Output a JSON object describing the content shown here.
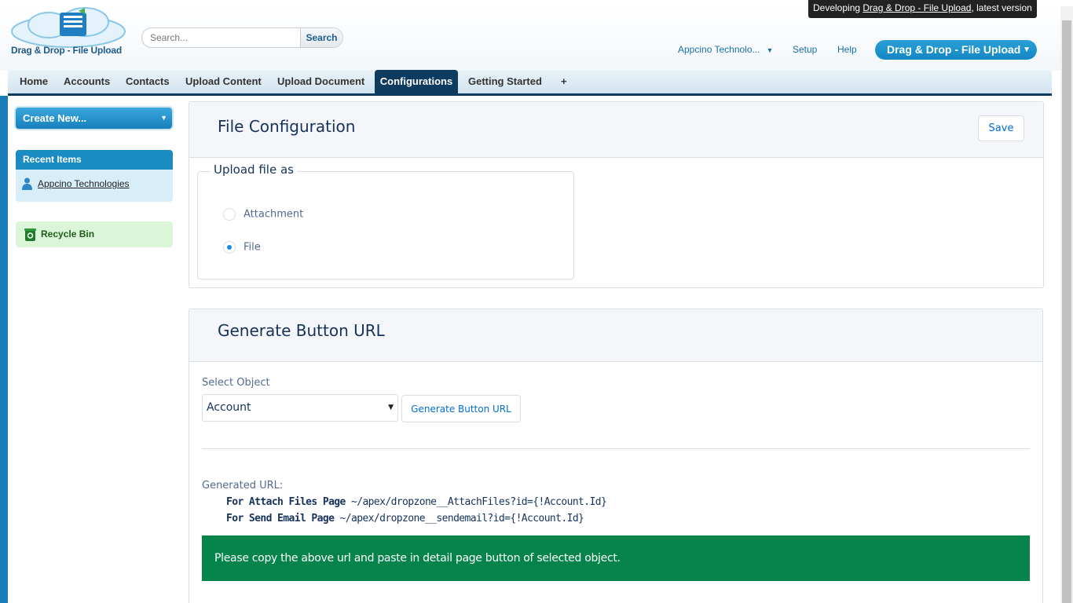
{
  "header": {
    "logo_text": "Drag & Drop - File Upload",
    "search_placeholder": "Search...",
    "search_button": "Search",
    "dev_banner_prefix": "Developing ",
    "dev_banner_link": "Drag & Drop - File Upload",
    "dev_banner_suffix": ", latest version",
    "user_menu": "Appcino Technolo...",
    "setup": "Setup",
    "help": "Help",
    "app_menu": "Drag & Drop - File Upload"
  },
  "tabs": [
    "Home",
    "Accounts",
    "Contacts",
    "Upload Content",
    "Upload Document",
    "Configurations",
    "Getting Started",
    "+"
  ],
  "active_tab": "Configurations",
  "sidebar": {
    "create_new": "Create New...",
    "recent_header": "Recent Items",
    "recent_items": [
      "Appcino Technologies"
    ],
    "recycle_bin": "Recycle Bin"
  },
  "file_config": {
    "title": "File Configuration",
    "save": "Save",
    "legend": "Upload file as",
    "options": [
      {
        "label": "Attachment",
        "checked": false
      },
      {
        "label": "File",
        "checked": true
      }
    ]
  },
  "generate": {
    "title": "Generate Button URL",
    "select_label": "Select Object",
    "select_value": "Account",
    "button": "Generate Button URL",
    "generated_label": "Generated URL:",
    "attach_label": "For Attach Files Page",
    "attach_url": " ~/apex/dropzone__AttachFiles?id={!Account.Id}",
    "email_label": "For Send Email Page",
    "email_url": " ~/apex/dropzone__sendemail?id={!Account.Id}",
    "notice": "Please copy the above url and paste in detail page button of selected object."
  },
  "colors": {
    "accent": "#1a8cc2",
    "nav_active": "#0e3c60",
    "success": "#04844b",
    "link": "#0070d2"
  }
}
